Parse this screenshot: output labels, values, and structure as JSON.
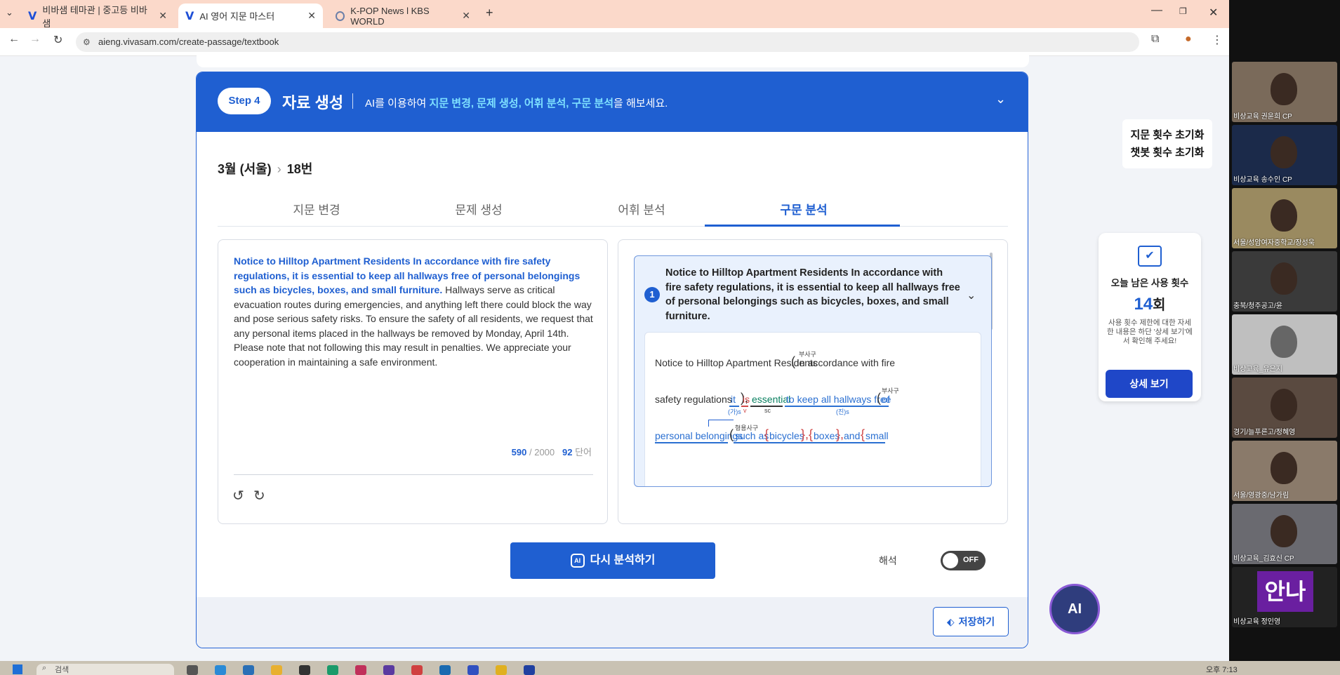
{
  "browser": {
    "tabs": [
      {
        "title": "비바샘 테마관 | 중고등 비바샘",
        "favicon": "vivasam-v-icon",
        "active": false
      },
      {
        "title": "AI 영어 지문 마스터",
        "favicon": "vivasam-v-icon",
        "active": true
      },
      {
        "title": "K-POP News l KBS WORLD",
        "favicon": "globe-icon",
        "active": false
      }
    ],
    "url": "aieng.vivasam.com/create-passage/textbook"
  },
  "step": {
    "badge": "Step 4",
    "title": "자료 생성",
    "desc_prefix": "AI를 이용하여 ",
    "desc_highlight": "지문 변경, 문제 생성, 어휘 분석, 구문 분석",
    "desc_suffix": "을 해보세요."
  },
  "breadcrumb": {
    "exam": "3월 (서울)",
    "sep": "›",
    "number": "18번"
  },
  "tabs": [
    "지문 변경",
    "문제 생성",
    "어휘 분석",
    "구문 분석"
  ],
  "passage": {
    "highlight": "Notice to Hilltop Apartment Residents In accordance with fire safety regulations, it is essential to keep all hallways free of personal belongings such as bicycles, boxes, and small furniture.",
    "rest": " Hallways serve as critical evacuation routes during emergencies, and anything left there could block the way and pose serious safety risks. To ensure the safety of all residents, we request that any personal items placed in the hallways be removed by Monday, April 14th. Please note that not following this may result in penalties. We appreciate your cooperation in maintaining a safe environment.",
    "char_count": "590",
    "char_max": "/ 2000",
    "word_count": "92",
    "word_unit": "단어"
  },
  "analysis": {
    "item_number": "1",
    "sentence": "Notice to Hilltop Apartment Residents In accordance with fire safety regulations, it is essential to keep all hallways free of personal belongings such as bicycles, boxes, and small furniture.",
    "tree": {
      "line1_plain": "Notice to Hilltop Apartment Residents",
      "line1_phrase": "In accordance with fire",
      "label_adv1": "부사구",
      "line2_a": "safety regulations",
      "it": "it",
      "is": "is",
      "essential": "essential",
      "to_keep": "to keep all hallways free",
      "of": "of",
      "label_adv2": "부사구",
      "label_it": "(가)s",
      "label_v": "v",
      "label_sc": "sc",
      "label_real": "(진)s",
      "line3_a": "personal belongings",
      "such_as": "such as",
      "bicycles": "bicycles",
      "boxes": "boxes",
      "and": "and",
      "small": "small",
      "label_adj": "형용사구"
    }
  },
  "buttons": {
    "reanalyze": "다시 분석하기",
    "reanalyze_icon": "AI",
    "save": "저장하기"
  },
  "toggle": {
    "label": "해석",
    "state": "OFF"
  },
  "reset": {
    "line1": "지문 횟수 초기화",
    "line2": "챗봇 횟수 초기화"
  },
  "usage": {
    "title": "오늘 남은 사용 횟수",
    "count": "14",
    "unit": "회",
    "desc": "사용 횟수 제한에 대한 자세한 내용은 하단 '상세 보기'에서 확인해 주세요!",
    "button": "상세 보기"
  },
  "ai_bubble": "AI",
  "video_participants": [
    "비상교육 권윤희 CP",
    "비상교육 송수인 CP",
    "서울/성암여자중학교/장성욱",
    "충북/청주공고/윤",
    "비상교육_유은지",
    "경기/늘푸른고/정혜영",
    "서울/영광중/남가림",
    "비상교육_김효신 CP",
    "비상교육 정인영"
  ],
  "video_avatar_text": "안나",
  "taskbar": {
    "search_placeholder": "검색",
    "clock": "오후 7:13"
  },
  "colors": {
    "primary": "#1f5fd1",
    "highlight": "#7ee0ff",
    "tabbar": "#fbd9ca"
  }
}
